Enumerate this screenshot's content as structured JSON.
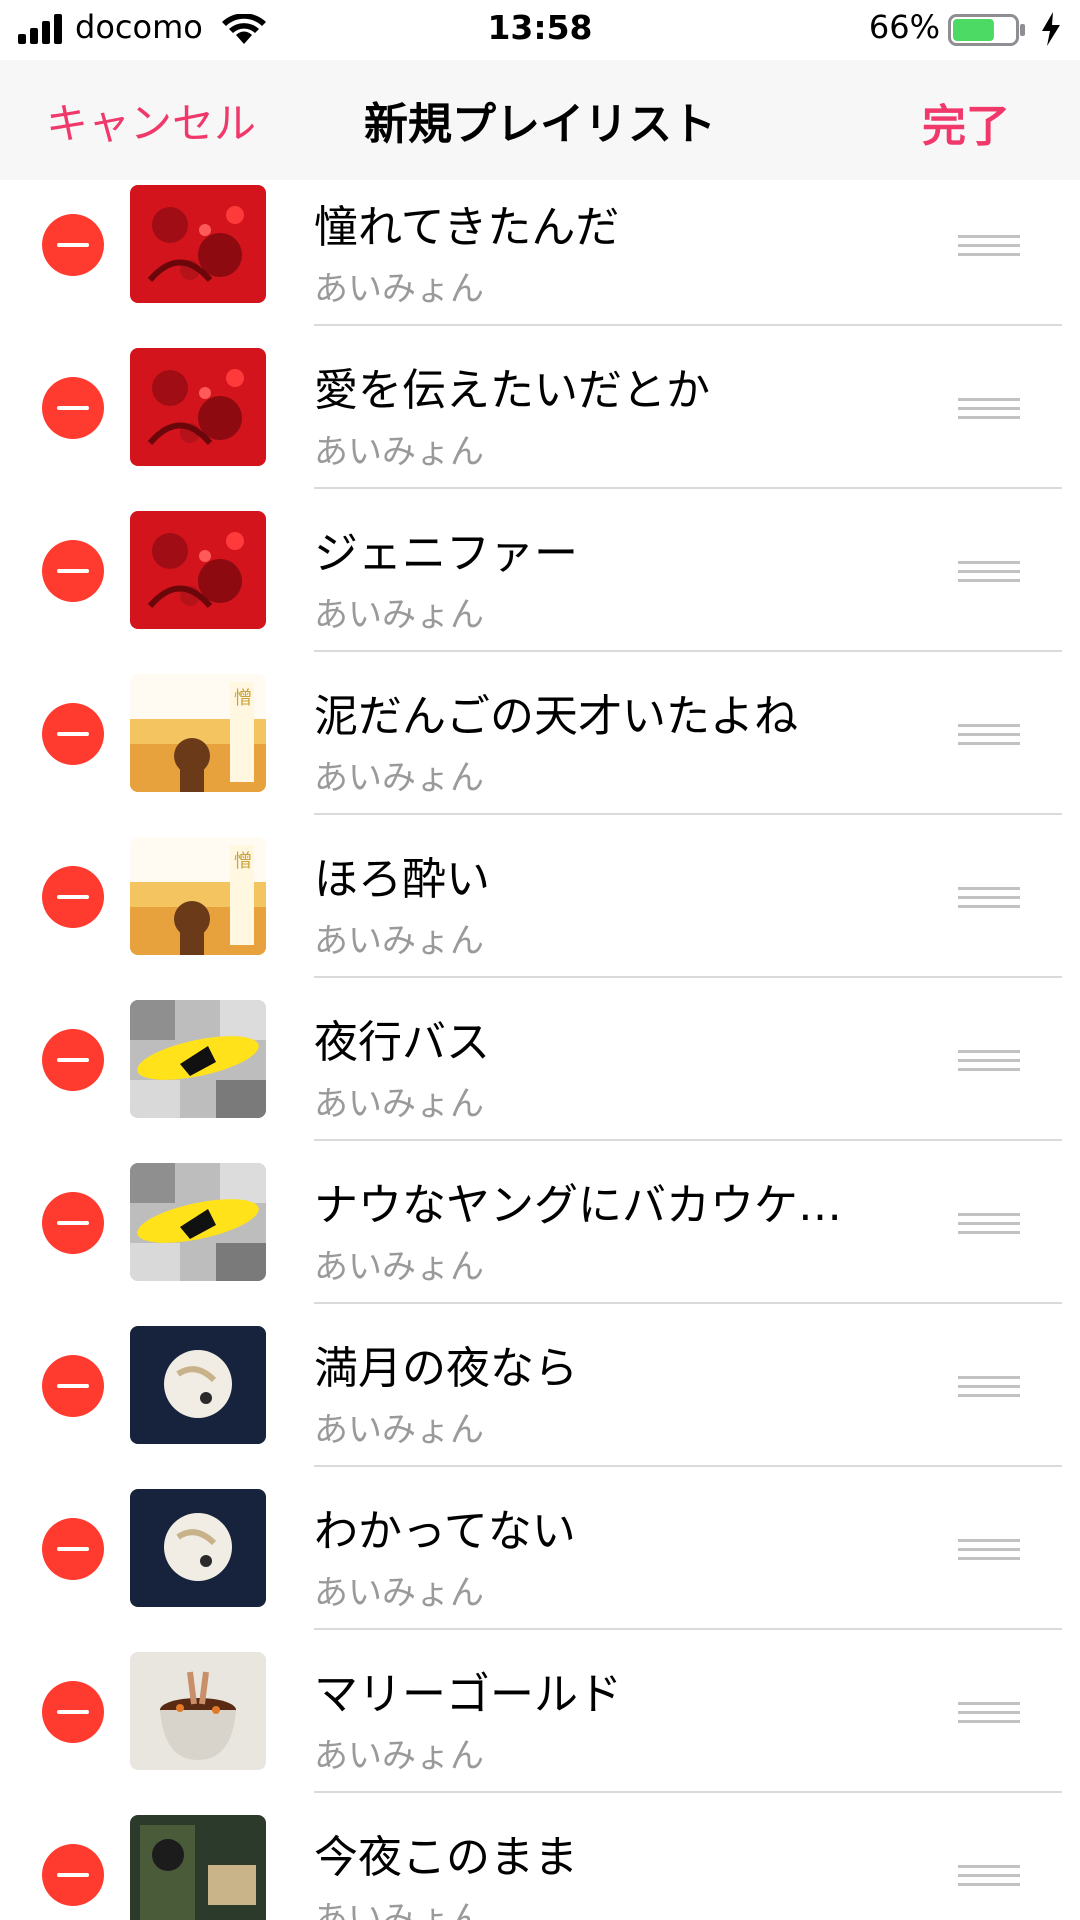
{
  "status_bar": {
    "carrier": "docomo",
    "time": "13:58",
    "battery_percent": "66%",
    "battery_level": 0.66
  },
  "nav": {
    "cancel_label": "キャンセル",
    "title": "新規プレイリスト",
    "done_label": "完了"
  },
  "colors": {
    "accent": "#f0386b",
    "delete": "#ff3b30",
    "secondary_text": "#9a9a9a",
    "battery_fill": "#4cd964"
  },
  "songs": [
    {
      "title": "憧れてきたんだ",
      "artist": "あいみょん",
      "art": "red-cover"
    },
    {
      "title": "愛を伝えたいだとか",
      "artist": "あいみょん",
      "art": "red-cover"
    },
    {
      "title": "ジェニファー",
      "artist": "あいみょん",
      "art": "red-cover"
    },
    {
      "title": "泥だんごの天才いたよね",
      "artist": "あいみょん",
      "art": "sunset-cover"
    },
    {
      "title": "ほろ酔い",
      "artist": "あいみょん",
      "art": "sunset-cover"
    },
    {
      "title": "夜行バス",
      "artist": "あいみょん",
      "art": "yellow-collage-cover"
    },
    {
      "title": "ナウなヤングにバカウケ…",
      "artist": "あいみょん",
      "art": "yellow-collage-cover"
    },
    {
      "title": "満月の夜なら",
      "artist": "あいみょん",
      "art": "moon-cover"
    },
    {
      "title": "わかってない",
      "artist": "あいみょん",
      "art": "moon-cover"
    },
    {
      "title": "マリーゴールド",
      "artist": "あいみょん",
      "art": "pot-cover"
    },
    {
      "title": "今夜このまま",
      "artist": "あいみょん",
      "art": "film-cover"
    }
  ]
}
